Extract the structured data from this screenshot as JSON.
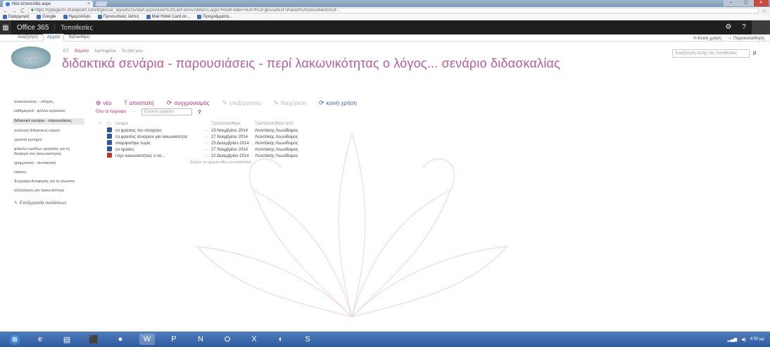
{
  "browser": {
    "tab_title": "Νέα Ιστοσελίδα.aspx",
    "url": "https://lyplagerm.sharepoint.com/it/glossa/_layouts/15/start.aspx#/Doc%20Lib/Forms/AllItems.aspx?RootFolder=%2Fit%2Fglossa%2FShared%20Documents%2F...",
    "bookmarks": [
      "Εφαρμογές",
      "Google",
      "Ημερολόγιο",
      "Προσωπικές λίστες",
      "Mail Hotel Card σε...",
      "Προγράμματα..."
    ],
    "window_controls": [
      "–",
      "▢",
      "✕"
    ]
  },
  "suite": {
    "brand": "Office 365",
    "site_link": "Τοποθεσίες",
    "gear": "⚙",
    "help": "?"
  },
  "ribbon": {
    "tabs": [
      "Αναζήτηση",
      "Αρχεία",
      "Βιβλιοθήκη"
    ],
    "active_index": 1,
    "right": [
      "Κοινή χρήση",
      "Παρακολούθηση"
    ]
  },
  "header": {
    "logo_text": "γλώσσα",
    "breadcrumbs": [
      "ΕΞ",
      "Θέματα",
      "Αγαπημένα",
      "Το σάιτ μου"
    ],
    "site_title": "διδακτικά σενάρια - παρουσιάσεις - περί λακωνικότητας ο λόγος... σενάριο διδασκαλίας",
    "search_placeholder": "Αναζήτηση αυτής της τοποθεσίας",
    "search_button": "ρ"
  },
  "leftnav": {
    "items": [
      "ανακοινώσεις - οδηγίες",
      "καθημερινά - φύλλα εργασιών",
      "διδακτικά σενάρια - παρουσιάσεις",
      "συλλογή διδακτικού υλικού",
      "γραπτά κριτήρια",
      "φάκελοι ομάδων εργασίας για τη διαφορά του λακωνικότητας",
      "γραμματική - συντακτικά",
      "εικόνες",
      "Έγγραφα Αναφοράς για τη γλώσσα",
      "αξιολόγηση για λακωνικότητα"
    ],
    "selected_index": 2,
    "edit_links": "Επεξεργασία συνδέσεων"
  },
  "commands": [
    {
      "icon": "⊕",
      "label": "νέο",
      "style": "pink"
    },
    {
      "icon": "⤒",
      "label": "αποστολή",
      "style": "pink"
    },
    {
      "icon": "⟳",
      "label": "συγχρονισμός",
      "style": "pink"
    },
    {
      "icon": "✎",
      "label": "επεξεργασία",
      "style": "dim"
    },
    {
      "icon": "✎",
      "label": "διαχείριση",
      "style": "dim"
    },
    {
      "icon": "⟳",
      "label": "κοινή χρήση",
      "style": "blue"
    }
  ],
  "view": {
    "name": "Όλα τα έγγραφα",
    "more": "···",
    "find_placeholder": "Εύρεση αρχείου",
    "find_icon": "⚲"
  },
  "table": {
    "headers": [
      "Όνομα",
      "Τροποποιήθηκε",
      "Τροποποιήθηκε από"
    ],
    "rows": [
      {
        "type": "ppt",
        "name": "Οι φράσεις του σενάριου",
        "dots": "···",
        "modified": "23 Νοεμβρίου 2014",
        "by": "Λεοντάκης Λεωνίδαμος"
      },
      {
        "type": "ppt",
        "name": "Οι φράσεις σενάριου για λακωνικότητα",
        "dots": "···",
        "modified": "27 Νοεμβρίου 2014",
        "by": "Λεοντάκης Λεωνίδαμος"
      },
      {
        "type": "ppt",
        "name": "σκαρφίστηκε τώρα",
        "dots": "···",
        "modified": "25 Δεκεμβρίου 2014",
        "by": "Λεοντάκης Λεωνίδαμος"
      },
      {
        "type": "ppt",
        "name": "Οι ομάδες",
        "dots": "···",
        "modified": "27 Νοεμβρίου 2014",
        "by": "Λεοντάκης Λεωνίδαμος"
      },
      {
        "type": "pdf",
        "name": "Περί λακωνικότητας ο λό...",
        "dots": "···",
        "modified": "22 Δεκεμβρίου 2014",
        "by": "Λεοντάκης Λεωνίδαμος"
      }
    ],
    "drag_note": "Σύρετε τα αρχεία εδώ για αποστολή"
  },
  "taskbar": {
    "apps": [
      "⊞",
      "e",
      "▤",
      "⬛",
      "●",
      "W",
      "P",
      "N",
      "⛭",
      "X",
      "◐",
      "S"
    ],
    "active_index": 5,
    "clock": "4:00 μμ"
  },
  "colors": {
    "accent": "#b0316f",
    "title": "#b45c9a",
    "suitebar": "#1f1f1f",
    "taskbar": "#2e5b9e"
  }
}
